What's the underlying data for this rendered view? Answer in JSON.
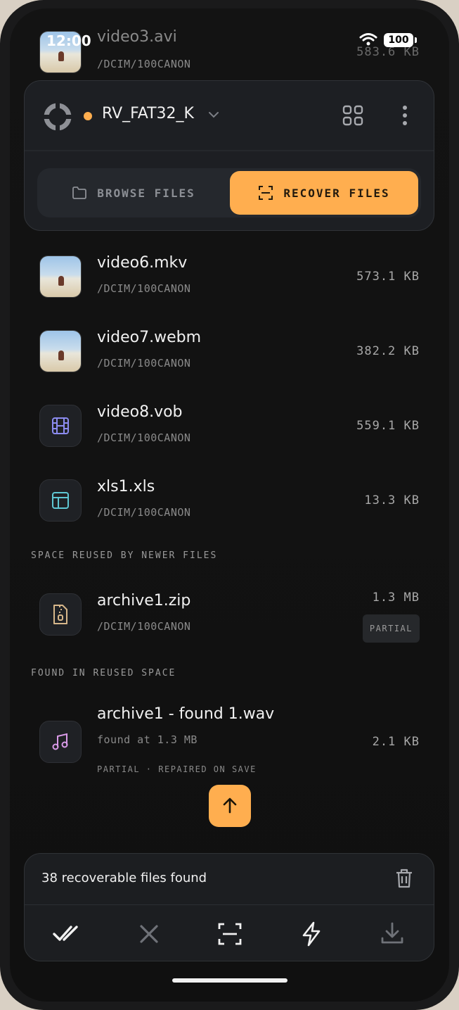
{
  "status_bar": {
    "time": "12:00",
    "battery": "100"
  },
  "header": {
    "device_name": "RV_FAT32_K",
    "tabs": [
      {
        "label": "BROWSE FILES",
        "active": false
      },
      {
        "label": "RECOVER FILES",
        "active": true
      }
    ]
  },
  "partial_row": {
    "name": "video3.avi",
    "path": "/DCIM/100CANON",
    "size": "583.6 KB"
  },
  "files": [
    {
      "name": "video6.mkv",
      "path": "/DCIM/100CANON",
      "size": "573.1 KB",
      "icon": "photo-thumbnail"
    },
    {
      "name": "video7.webm",
      "path": "/DCIM/100CANON",
      "size": "382.2 KB",
      "icon": "photo-thumbnail"
    },
    {
      "name": "video8.vob",
      "path": "/DCIM/100CANON",
      "size": "559.1 KB",
      "icon": "film-icon"
    },
    {
      "name": "xls1.xls",
      "path": "/DCIM/100CANON",
      "size": "13.3 KB",
      "icon": "table-icon"
    }
  ],
  "section_reused": {
    "title": "SPACE REUSED BY NEWER FILES",
    "items": [
      {
        "name": "archive1.zip",
        "path": "/DCIM/100CANON",
        "size": "1.3 MB",
        "badge": "PARTIAL",
        "icon": "zip-icon"
      }
    ]
  },
  "section_found": {
    "title": "FOUND IN REUSED SPACE",
    "items": [
      {
        "name": "archive1 - found 1.wav",
        "detail": "found at 1.3 MB",
        "note": "PARTIAL · REPAIRED ON SAVE",
        "size": "2.1 KB",
        "icon": "music-icon"
      }
    ]
  },
  "summary": {
    "text": "38 recoverable files found"
  },
  "colors": {
    "accent": "#ffae4f",
    "status_dot": "#ffae4f",
    "film": "#8c8cf0",
    "table": "#5fc7d3",
    "zip": "#d7b78a",
    "music": "#d99ae8"
  }
}
